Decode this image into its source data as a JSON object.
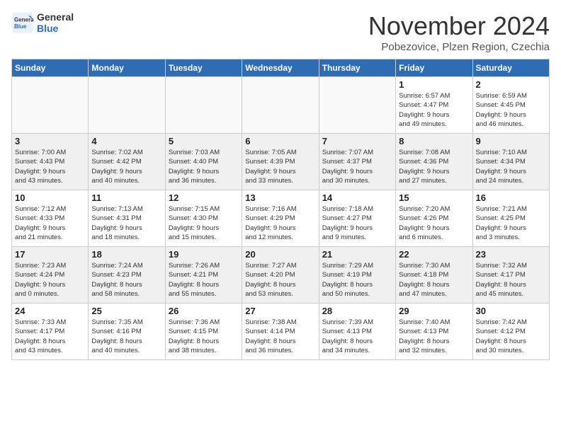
{
  "logo": {
    "line1": "General",
    "line2": "Blue"
  },
  "title": "November 2024",
  "subtitle": "Pobezovice, Plzen Region, Czechia",
  "weekdays": [
    "Sunday",
    "Monday",
    "Tuesday",
    "Wednesday",
    "Thursday",
    "Friday",
    "Saturday"
  ],
  "weeks": [
    [
      {
        "day": "",
        "info": ""
      },
      {
        "day": "",
        "info": ""
      },
      {
        "day": "",
        "info": ""
      },
      {
        "day": "",
        "info": ""
      },
      {
        "day": "",
        "info": ""
      },
      {
        "day": "1",
        "info": "Sunrise: 6:57 AM\nSunset: 4:47 PM\nDaylight: 9 hours\nand 49 minutes."
      },
      {
        "day": "2",
        "info": "Sunrise: 6:59 AM\nSunset: 4:45 PM\nDaylight: 9 hours\nand 46 minutes."
      }
    ],
    [
      {
        "day": "3",
        "info": "Sunrise: 7:00 AM\nSunset: 4:43 PM\nDaylight: 9 hours\nand 43 minutes."
      },
      {
        "day": "4",
        "info": "Sunrise: 7:02 AM\nSunset: 4:42 PM\nDaylight: 9 hours\nand 40 minutes."
      },
      {
        "day": "5",
        "info": "Sunrise: 7:03 AM\nSunset: 4:40 PM\nDaylight: 9 hours\nand 36 minutes."
      },
      {
        "day": "6",
        "info": "Sunrise: 7:05 AM\nSunset: 4:39 PM\nDaylight: 9 hours\nand 33 minutes."
      },
      {
        "day": "7",
        "info": "Sunrise: 7:07 AM\nSunset: 4:37 PM\nDaylight: 9 hours\nand 30 minutes."
      },
      {
        "day": "8",
        "info": "Sunrise: 7:08 AM\nSunset: 4:36 PM\nDaylight: 9 hours\nand 27 minutes."
      },
      {
        "day": "9",
        "info": "Sunrise: 7:10 AM\nSunset: 4:34 PM\nDaylight: 9 hours\nand 24 minutes."
      }
    ],
    [
      {
        "day": "10",
        "info": "Sunrise: 7:12 AM\nSunset: 4:33 PM\nDaylight: 9 hours\nand 21 minutes."
      },
      {
        "day": "11",
        "info": "Sunrise: 7:13 AM\nSunset: 4:31 PM\nDaylight: 9 hours\nand 18 minutes."
      },
      {
        "day": "12",
        "info": "Sunrise: 7:15 AM\nSunset: 4:30 PM\nDaylight: 9 hours\nand 15 minutes."
      },
      {
        "day": "13",
        "info": "Sunrise: 7:16 AM\nSunset: 4:29 PM\nDaylight: 9 hours\nand 12 minutes."
      },
      {
        "day": "14",
        "info": "Sunrise: 7:18 AM\nSunset: 4:27 PM\nDaylight: 9 hours\nand 9 minutes."
      },
      {
        "day": "15",
        "info": "Sunrise: 7:20 AM\nSunset: 4:26 PM\nDaylight: 9 hours\nand 6 minutes."
      },
      {
        "day": "16",
        "info": "Sunrise: 7:21 AM\nSunset: 4:25 PM\nDaylight: 9 hours\nand 3 minutes."
      }
    ],
    [
      {
        "day": "17",
        "info": "Sunrise: 7:23 AM\nSunset: 4:24 PM\nDaylight: 9 hours\nand 0 minutes."
      },
      {
        "day": "18",
        "info": "Sunrise: 7:24 AM\nSunset: 4:23 PM\nDaylight: 8 hours\nand 58 minutes."
      },
      {
        "day": "19",
        "info": "Sunrise: 7:26 AM\nSunset: 4:21 PM\nDaylight: 8 hours\nand 55 minutes."
      },
      {
        "day": "20",
        "info": "Sunrise: 7:27 AM\nSunset: 4:20 PM\nDaylight: 8 hours\nand 53 minutes."
      },
      {
        "day": "21",
        "info": "Sunrise: 7:29 AM\nSunset: 4:19 PM\nDaylight: 8 hours\nand 50 minutes."
      },
      {
        "day": "22",
        "info": "Sunrise: 7:30 AM\nSunset: 4:18 PM\nDaylight: 8 hours\nand 47 minutes."
      },
      {
        "day": "23",
        "info": "Sunrise: 7:32 AM\nSunset: 4:17 PM\nDaylight: 8 hours\nand 45 minutes."
      }
    ],
    [
      {
        "day": "24",
        "info": "Sunrise: 7:33 AM\nSunset: 4:17 PM\nDaylight: 8 hours\nand 43 minutes."
      },
      {
        "day": "25",
        "info": "Sunrise: 7:35 AM\nSunset: 4:16 PM\nDaylight: 8 hours\nand 40 minutes."
      },
      {
        "day": "26",
        "info": "Sunrise: 7:36 AM\nSunset: 4:15 PM\nDaylight: 8 hours\nand 38 minutes."
      },
      {
        "day": "27",
        "info": "Sunrise: 7:38 AM\nSunset: 4:14 PM\nDaylight: 8 hours\nand 36 minutes."
      },
      {
        "day": "28",
        "info": "Sunrise: 7:39 AM\nSunset: 4:13 PM\nDaylight: 8 hours\nand 34 minutes."
      },
      {
        "day": "29",
        "info": "Sunrise: 7:40 AM\nSunset: 4:13 PM\nDaylight: 8 hours\nand 32 minutes."
      },
      {
        "day": "30",
        "info": "Sunrise: 7:42 AM\nSunset: 4:12 PM\nDaylight: 8 hours\nand 30 minutes."
      }
    ]
  ]
}
